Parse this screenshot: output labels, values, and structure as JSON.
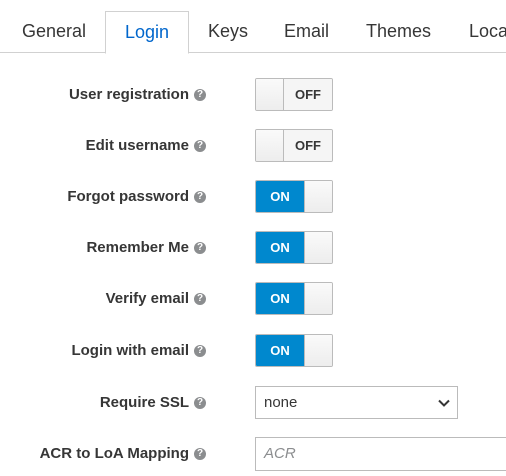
{
  "tabs": [
    {
      "label": "General",
      "active": false
    },
    {
      "label": "Login",
      "active": true
    },
    {
      "label": "Keys",
      "active": false
    },
    {
      "label": "Email",
      "active": false
    },
    {
      "label": "Themes",
      "active": false
    },
    {
      "label": "Loca",
      "active": false
    }
  ],
  "settings": {
    "user_registration": {
      "label": "User registration",
      "state": "OFF"
    },
    "edit_username": {
      "label": "Edit username",
      "state": "OFF"
    },
    "forgot_password": {
      "label": "Forgot password",
      "state": "ON"
    },
    "remember_me": {
      "label": "Remember Me",
      "state": "ON"
    },
    "verify_email": {
      "label": "Verify email",
      "state": "ON"
    },
    "login_with_email": {
      "label": "Login with email",
      "state": "ON"
    },
    "require_ssl": {
      "label": "Require SSL",
      "value": "none"
    },
    "acr_mapping": {
      "label": "ACR to LoA Mapping",
      "placeholder": "ACR"
    }
  },
  "icons": {
    "help": "question-circle-icon",
    "select": "chevron-down-icon"
  },
  "colors": {
    "accent": "#0066cc",
    "switch_on": "#0088ce",
    "border": "#bbbbbb"
  }
}
